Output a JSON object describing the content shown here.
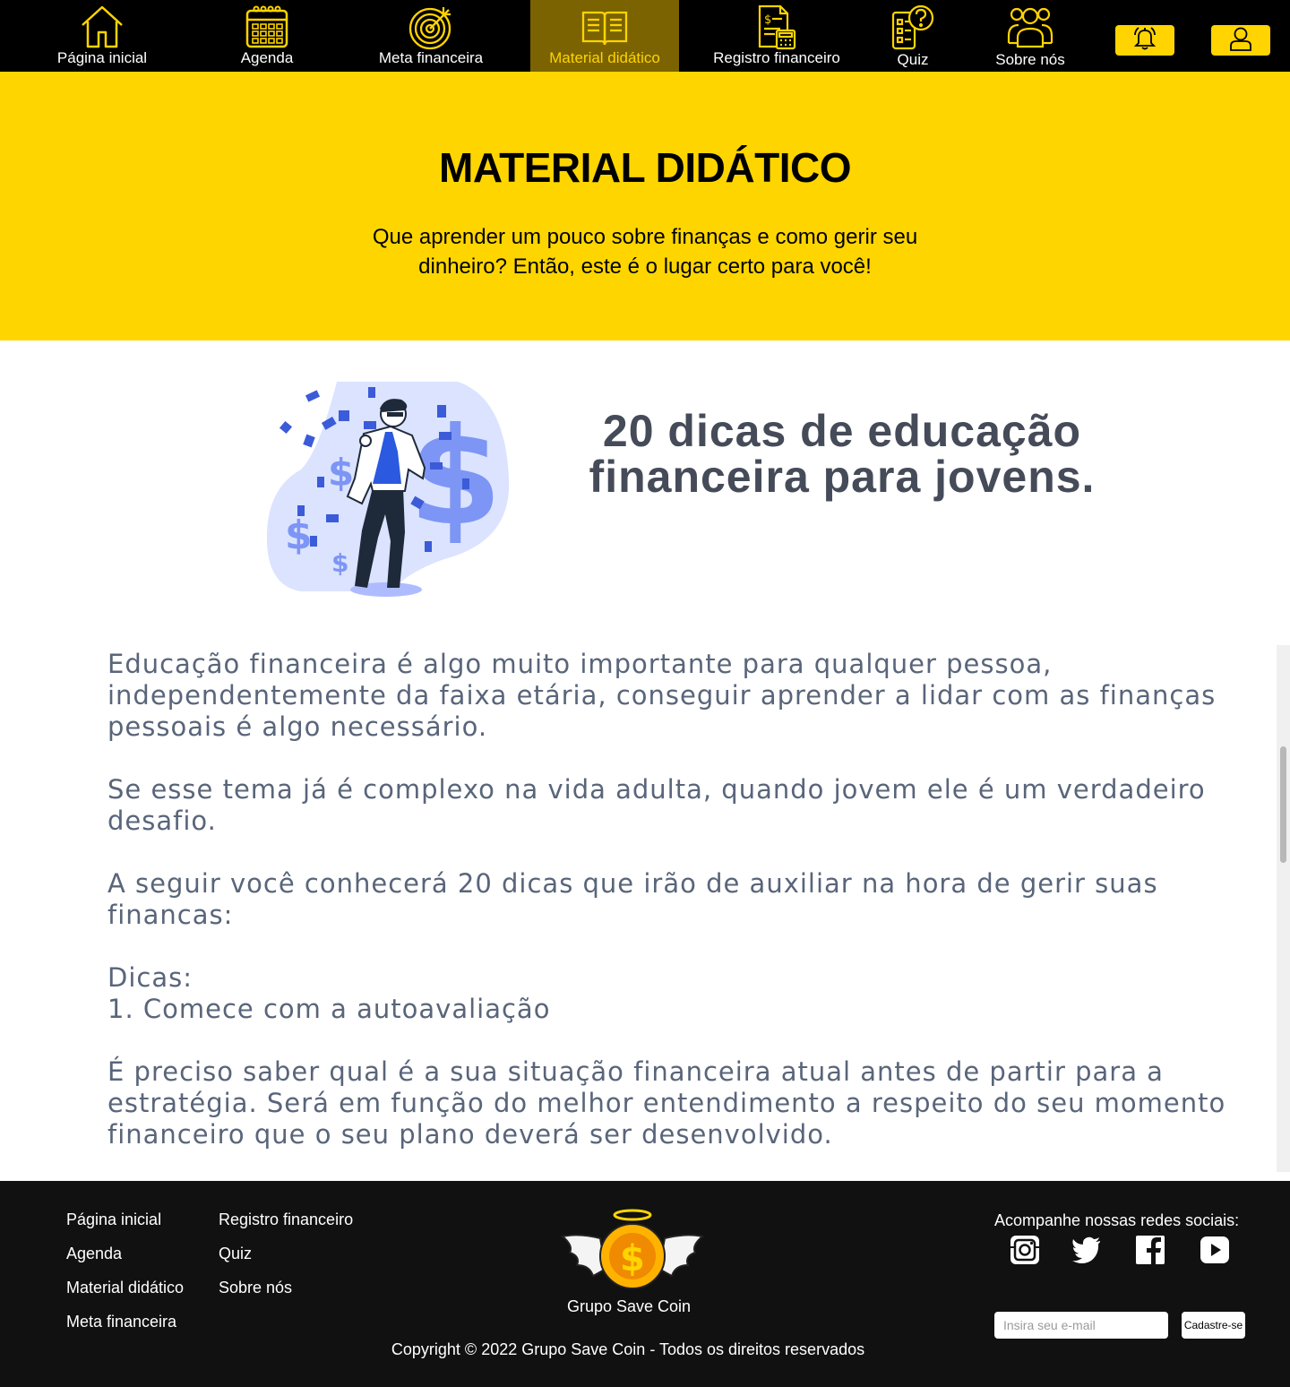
{
  "nav": {
    "items": [
      {
        "label": "Página inicial",
        "icon": "home-icon"
      },
      {
        "label": "Agenda",
        "icon": "calendar-icon"
      },
      {
        "label": "Meta financeira",
        "icon": "target-icon"
      },
      {
        "label": "Material didático",
        "icon": "book-icon",
        "active": true
      },
      {
        "label": "Registro financeiro",
        "icon": "ledger-calculator-icon"
      },
      {
        "label": "Quiz",
        "icon": "quiz-question-icon"
      },
      {
        "label": "Sobre nós",
        "icon": "group-icon"
      }
    ],
    "notification_icon": "bell-icon",
    "profile_icon": "user-icon",
    "accent": "#ffd400"
  },
  "hero": {
    "title": "MATERIAL DIDÁTICO",
    "subtitle": "Que aprender um pouco sobre finanças e como gerir seu dinheiro? Então, este é o lugar certo para você!",
    "background": "#ffd500"
  },
  "article": {
    "title": "20 dicas de educação financeira para jovens.",
    "illustration": "man-throwing-money-illustration",
    "body": "Educação financeira é algo muito importante para qualquer pessoa, independentemente da faixa etária, conseguir aprender a lidar com as finanças pessoais é algo necessário.\n\nSe esse tema já é complexo na vida adulta, quando jovem ele é um verdadeiro desafio.\n\nA seguir você conhecerá 20 dicas que irão de auxiliar na hora de gerir suas financas:\n\nDicas:\n1. Comece com a autoavaliação\n\nÉ preciso saber qual é a sua situação financeira atual antes de partir para a estratégia. Será em função do melhor entendimento a respeito do seu momento financeiro que o seu plano deverá ser desenvolvido."
  },
  "footer": {
    "links_col1": [
      "Página inicial",
      "Agenda",
      "Material didático",
      "Meta financeira"
    ],
    "links_col2": [
      "Registro financeiro",
      "Quiz",
      "Sobre nós"
    ],
    "brand": "Grupo Save Coin",
    "logo_icon": "winged-coin-logo",
    "social_title": "Acompanhe nossas redes sociais:",
    "social": [
      "instagram-icon",
      "twitter-icon",
      "facebook-icon",
      "youtube-icon"
    ],
    "email_placeholder": "Insira seu e-mail",
    "submit_label": "Cadastre-se",
    "copyright": "Copyright © 2022 Grupo Save Coin - Todos os direitos reservados"
  }
}
